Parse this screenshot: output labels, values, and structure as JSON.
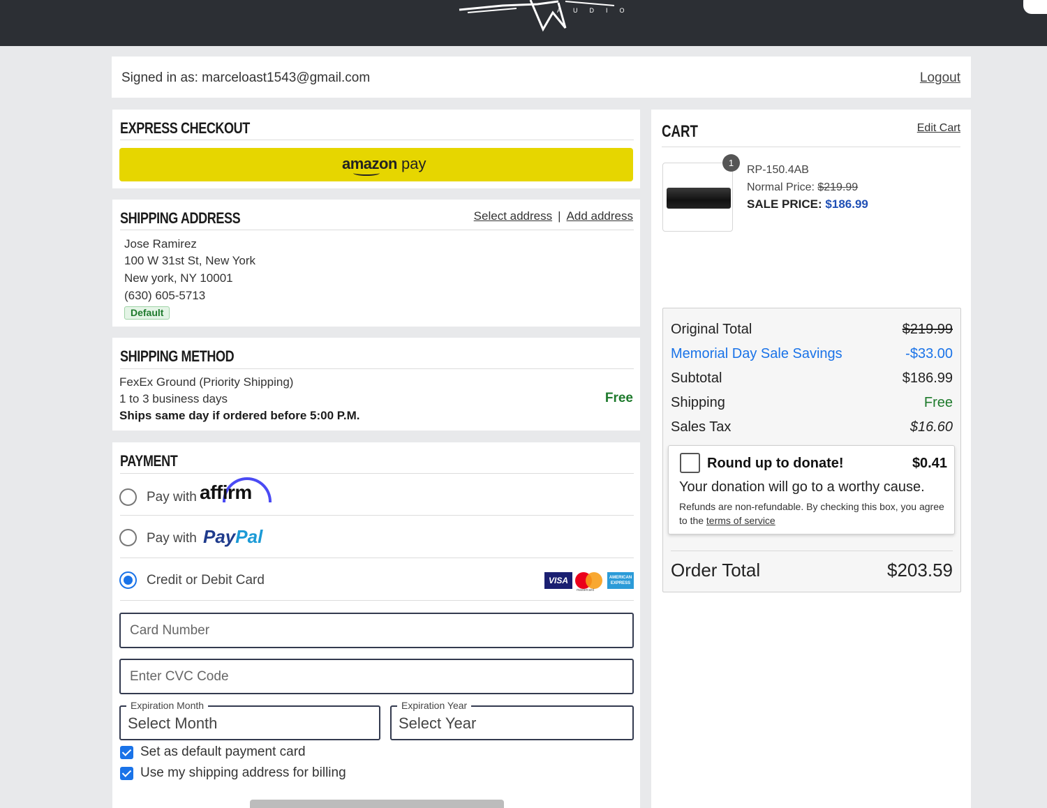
{
  "header": {
    "logo_letters": "AUDIO"
  },
  "account": {
    "signed_in_text": "Signed in as: marceloast1543@gmail.com",
    "logout_label": "Logout"
  },
  "express": {
    "title": "EXPRESS CHECKOUT",
    "amazon_bold": "amazon",
    "amazon_rest": " pay"
  },
  "shipping_address": {
    "title": "SHIPPING ADDRESS",
    "select_label": "Select address",
    "separator": "|",
    "add_label": "Add address",
    "lines": [
      "Jose Ramirez",
      "100 W 31st St, New York",
      "New york, NY 10001",
      "(630) 605-5713"
    ],
    "badge": "Default"
  },
  "shipping_method": {
    "title": "SHIPPING METHOD",
    "name": "FexEx Ground (Priority Shipping)",
    "days": "1 to 3 business days",
    "note": "Ships same day if ordered before 5:00 P.M.",
    "price": "Free"
  },
  "payment": {
    "title": "PAYMENT",
    "options": [
      {
        "prefix": "Pay with",
        "brand": "affirm",
        "selected": false
      },
      {
        "prefix": "Pay with",
        "brand_a": "Pay",
        "brand_b": "Pal",
        "selected": false
      },
      {
        "label": "Credit or Debit Card",
        "selected": true
      }
    ],
    "card_logos": {
      "visa": "VISA",
      "mastercard": "mastercard",
      "amex": "AMERICAN EXPRESS"
    },
    "card_number_placeholder": "Card Number",
    "cvc_placeholder": "Enter CVC Code",
    "exp_month_legend": "Expiration Month",
    "exp_month_value": "Select Month",
    "exp_year_legend": "Expiration Year",
    "exp_year_value": "Select Year",
    "checkboxes": [
      {
        "label": "Set as default payment card",
        "checked": true
      },
      {
        "label": "Use my shipping address for billing",
        "checked": true
      }
    ]
  },
  "cart": {
    "title": "CART",
    "edit_label": "Edit Cart",
    "item": {
      "qty": "1",
      "sku": "RP-150.4AB",
      "normal_label": "Normal Price: ",
      "normal_price": "$219.99",
      "sale_label": "SALE PRICE: ",
      "sale_price": "$186.99"
    },
    "totals": {
      "original_label": "Original Total",
      "original_value": "$219.99",
      "savings_label": "Memorial Day Sale Savings",
      "savings_value": "-$33.00",
      "subtotal_label": "Subtotal",
      "subtotal_value": "$186.99",
      "shipping_label": "Shipping",
      "shipping_value": "Free",
      "tax_label": "Sales Tax",
      "tax_value": "$16.60"
    },
    "donate": {
      "title": "Round up to donate!",
      "amount": "$0.41",
      "description": "Your donation will go to a worthy cause.",
      "fine_print": "Refunds are non-refundable. By checking this box, you agree to the ",
      "terms_link": "terms of service"
    },
    "order_total_label": "Order Total",
    "order_total_value": "$203.59"
  },
  "colors": {
    "accent_blue": "#1a73e8",
    "free_green": "#1e7a2c",
    "amazon_yellow": "#e6d600",
    "header_dark": "#2c2f34"
  }
}
